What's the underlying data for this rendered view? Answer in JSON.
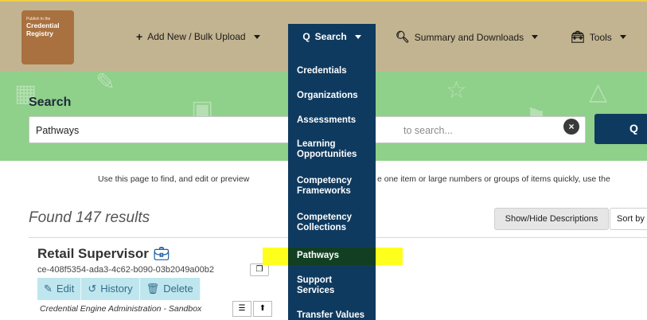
{
  "logo": {
    "small_text": "Publish to the",
    "line1": "Credential",
    "line2": "Registry"
  },
  "nav": {
    "add_new": "Add New / Bulk Upload",
    "search": "Search",
    "summary": "Summary and Downloads",
    "tools": "Tools"
  },
  "search": {
    "title": "Search",
    "value": "Pathways",
    "placeholder": "to search..."
  },
  "info": {
    "text_left": "Use this page to find, and edit or preview",
    "text_right": "e one item or large numbers or groups of items quickly, use the"
  },
  "results": {
    "found": "Found 147 results",
    "show_hide": "Show/Hide Descriptions",
    "sort_by": "Sort by"
  },
  "result_item": {
    "title": "Retail Supervisor",
    "ctid": "ce-408f5354-ada3-4c62-b090-03b2049a00b2",
    "edit": "Edit",
    "history": "History",
    "delete": "Delete",
    "organization": "Credential Engine Administration - Sandbox"
  },
  "dropdown": {
    "items": [
      "Credentials",
      "Organizations",
      "Assessments",
      "Learning Opportunities",
      "Competency Frameworks",
      "Competency Collections",
      "Pathways",
      "Support Services",
      "Transfer Values"
    ]
  },
  "colors": {
    "nav_bg": "#c3b491",
    "dropdown_bg": "#0f3a5f",
    "hero_bg": "#8fd08a",
    "highlight": "#ffff1e"
  }
}
